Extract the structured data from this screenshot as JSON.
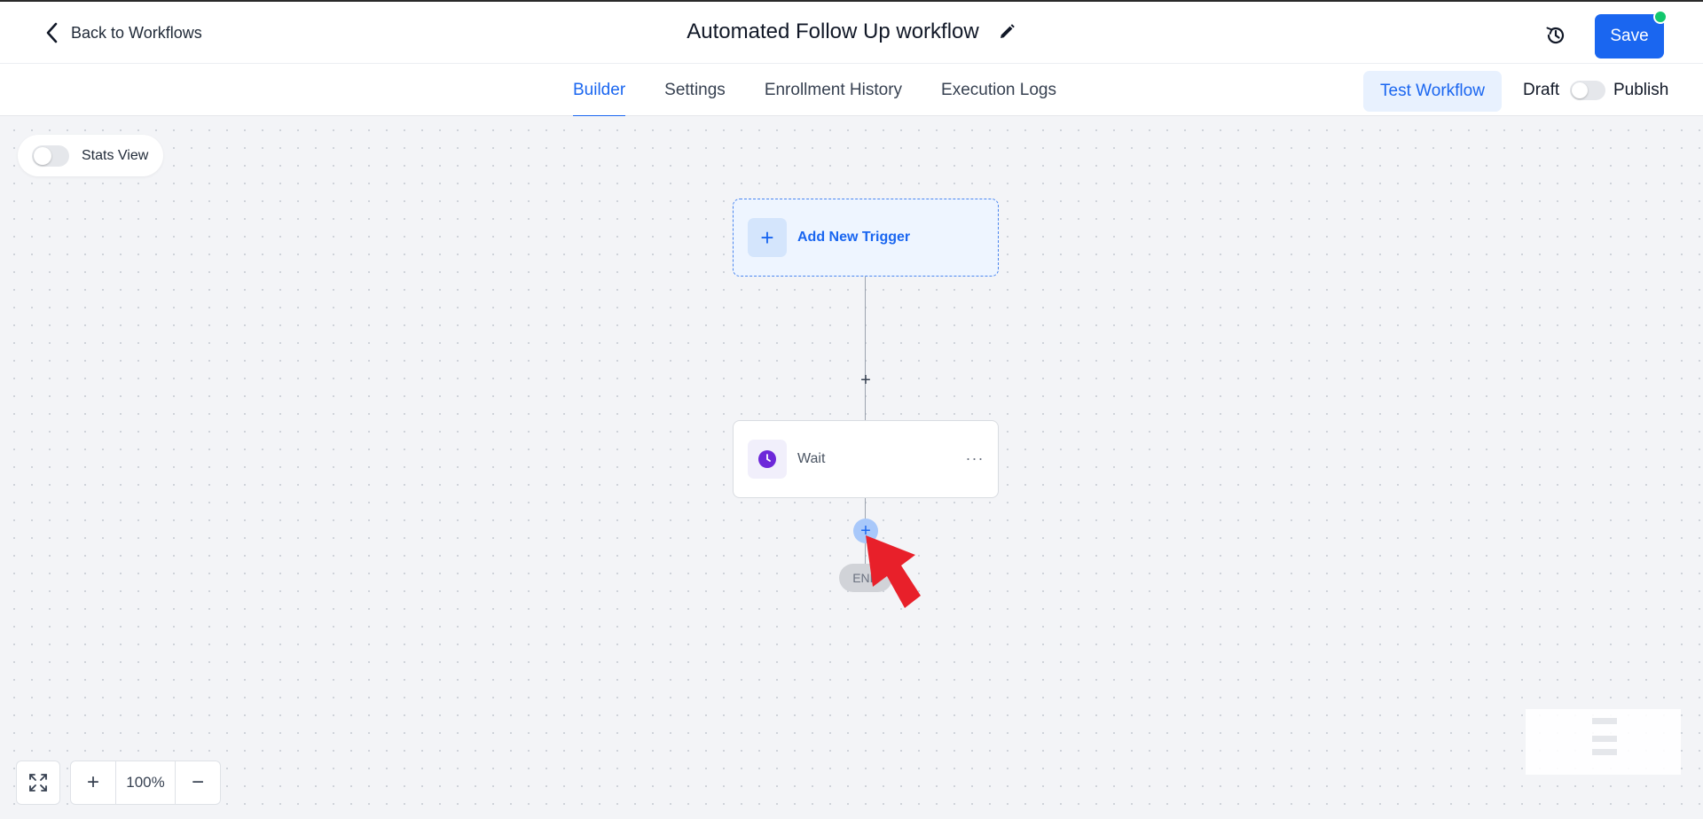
{
  "header": {
    "back_label": "Back to Workflows",
    "title": "Automated Follow Up workflow",
    "save_label": "Save"
  },
  "tabs": [
    {
      "label": "Builder",
      "active": true
    },
    {
      "label": "Settings",
      "active": false
    },
    {
      "label": "Enrollment History",
      "active": false
    },
    {
      "label": "Execution Logs",
      "active": false
    }
  ],
  "actions": {
    "test_workflow_label": "Test Workflow",
    "draft_label": "Draft",
    "publish_label": "Publish",
    "published": false
  },
  "canvas": {
    "stats_view_label": "Stats View",
    "stats_view_enabled": false,
    "trigger_label": "Add New Trigger",
    "action_label": "Wait",
    "end_label": "END",
    "zoom_level": "100%"
  },
  "icons": {
    "back": "chevron-left-icon",
    "edit": "pencil-icon",
    "history": "history-icon",
    "add": "plus-icon",
    "wait": "clock-icon",
    "more": "ellipsis-icon",
    "fit": "fullscreen-icon",
    "zoom_in": "plus-icon",
    "zoom_out": "minus-icon"
  },
  "colors": {
    "accent": "#1a66f0",
    "save_status": "#12c76d",
    "wait_icon": "#6d28d9",
    "pointer": "#e8202a"
  }
}
